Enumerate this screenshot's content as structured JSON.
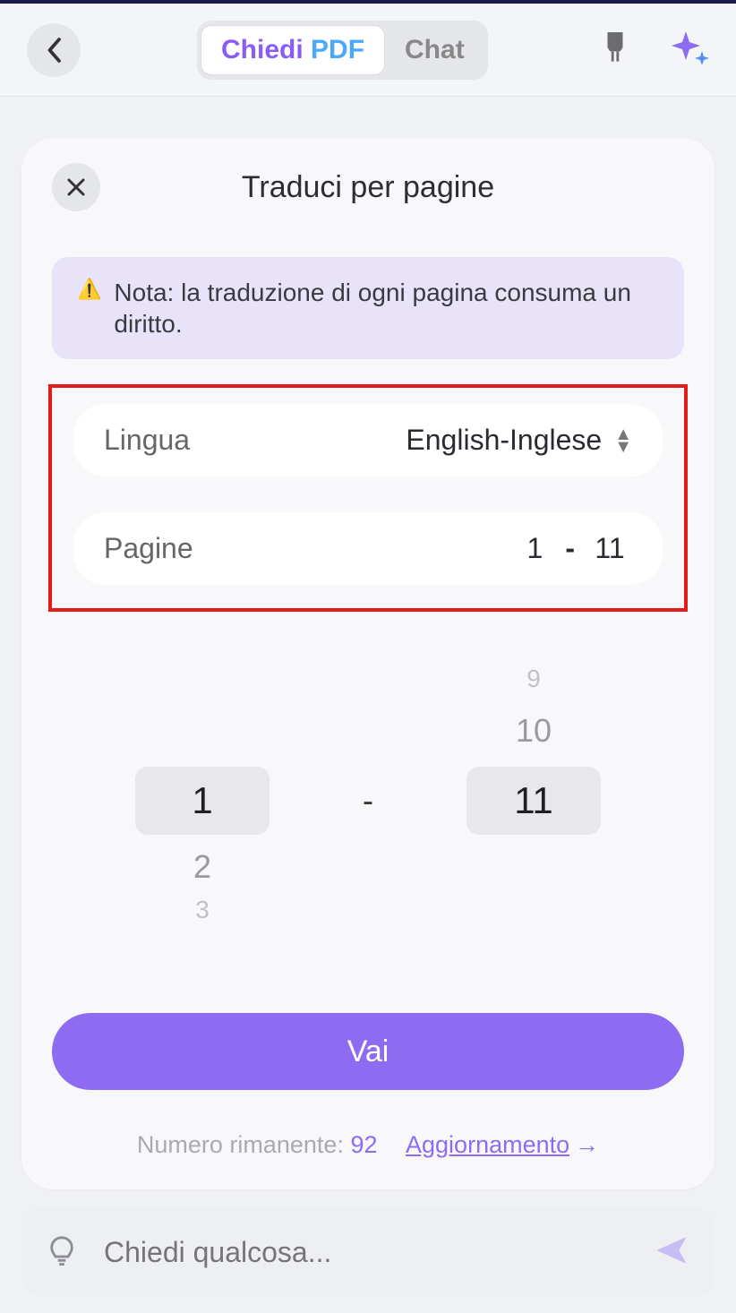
{
  "header": {
    "tabs": {
      "active_ask": "Chiedi",
      "active_pdf": "PDF",
      "chat": "Chat"
    }
  },
  "modal": {
    "title": "Traduci per pagine",
    "note": "Nota: la traduzione di ogni pagina consuma un diritto.",
    "lang_label": "Lingua",
    "lang_value": "English-Inglese",
    "pages_label": "Pagine",
    "pages_from": "1",
    "pages_dash": "-",
    "pages_to": "11",
    "picker_left_sel": "1",
    "picker_left_below1": "2",
    "picker_left_below2": "3",
    "picker_right_sel": "11",
    "picker_right_above1": "10",
    "picker_right_above2": "9",
    "picker_dash": "-",
    "go": "Vai",
    "remaining_label": "Numero rimanente: ",
    "remaining_count": "92",
    "upgrade": "Aggiornamento",
    "upgrade_arrow": "→"
  },
  "askbar": {
    "placeholder": "Chiedi qualcosa..."
  }
}
